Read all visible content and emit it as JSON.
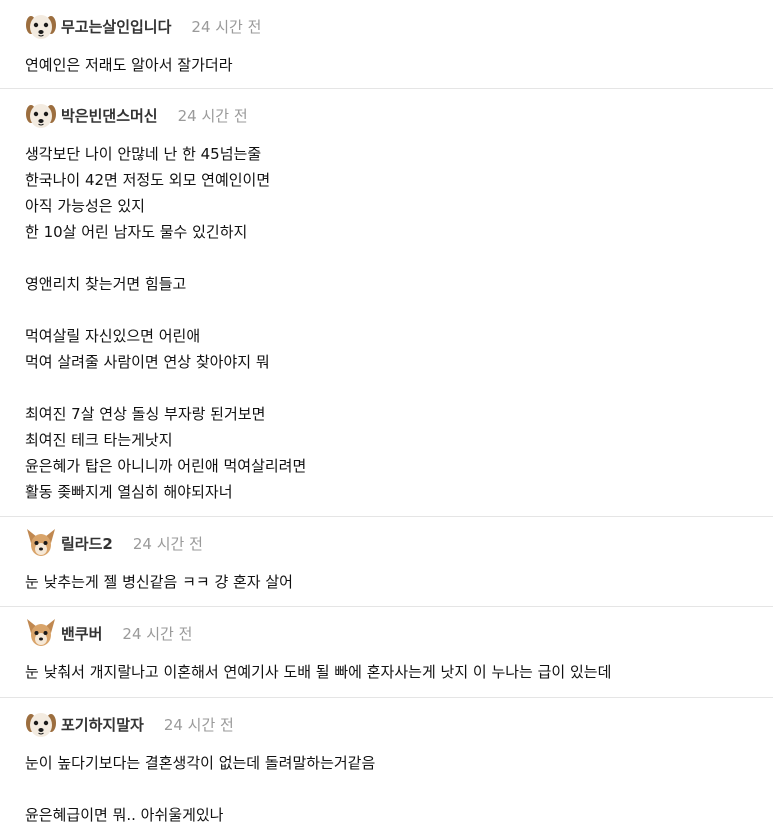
{
  "comments": [
    {
      "avatar": "dog-avatar-icon",
      "nickname": "무고는살인입니다",
      "time": "24 시간 전",
      "lines": [
        "연예인은 저래도 알아서 잘가더라"
      ]
    },
    {
      "avatar": "dog-avatar-icon",
      "nickname": "박은빈댄스머신",
      "time": "24 시간 전",
      "lines": [
        "생각보단 나이 안많네 난 한 45넘는줄",
        "한국나이 42면 저정도 외모 연예인이면",
        "아직 가능성은 있지",
        "한 10살 어린 남자도 물수 있긴하지",
        "",
        "영앤리치 찾는거면 힘들고",
        "",
        "먹여살릴 자신있으면 어린애",
        "먹여 살려줄 사람이면 연상 찾아야지 뭐",
        "",
        "최여진 7살 연상 돌싱 부자랑 된거보면",
        "최여진 테크 타는게낫지",
        "윤은혜가 탑은 아니니까 어린애 먹여살리려면",
        "활동 좆빠지게 열심히 해야되자너"
      ]
    },
    {
      "avatar": "chihuahua-avatar-icon",
      "nickname": "릴라드2",
      "time": "24 시간 전",
      "lines": [
        "눈 낮추는게 젤 병신같음 ㅋㅋ 걍 혼자 살어"
      ]
    },
    {
      "avatar": "chihuahua-avatar-icon",
      "nickname": "밴쿠버",
      "time": "24 시간 전",
      "lines": [
        "눈 낮춰서 개지랄나고 이혼해서 연예기사 도배 될 빠에 혼자사는게 낫지 이 누나는 급이 있는데"
      ]
    },
    {
      "avatar": "dog-avatar-icon",
      "nickname": "포기하지말자",
      "time": "24 시간 전",
      "lines": [
        "눈이 높다기보다는 결혼생각이 없는데 돌려말하는거같음",
        "",
        "윤은혜급이면 뭐.. 아쉬울게있나"
      ]
    }
  ]
}
